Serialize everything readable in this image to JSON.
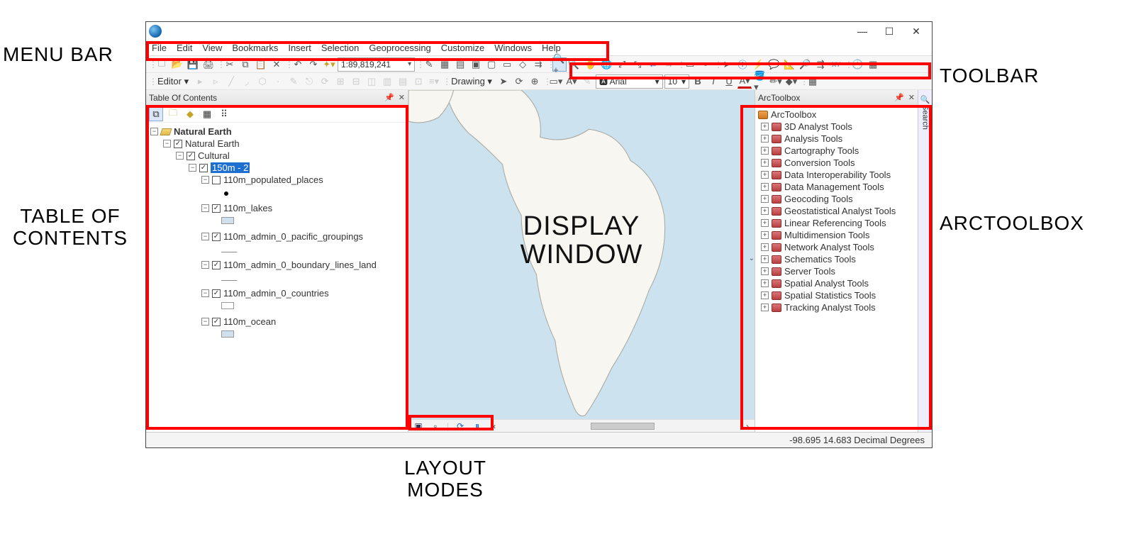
{
  "annotations": {
    "menubar": "MENU BAR",
    "toolbar": "TOOLBAR",
    "toc": "TABLE OF\nCONTENTS",
    "arctoolbox": "ARCTOOLBOX",
    "display": "DISPLAY\nWINDOW",
    "layoutmodes": "LAYOUT\nMODES"
  },
  "menubar": {
    "items": [
      "File",
      "Edit",
      "View",
      "Bookmarks",
      "Insert",
      "Selection",
      "Geoprocessing",
      "Customize",
      "Windows",
      "Help"
    ]
  },
  "toolbar": {
    "scale": "1:89,819,241",
    "editor_label": "Editor ▾",
    "drawing_label": "Drawing ▾",
    "font": "Arial",
    "font_size": "10"
  },
  "toc": {
    "title": "Table Of Contents",
    "root": "Natural Earth",
    "dataframe": "Natural Earth",
    "group": "Cultural",
    "sel_layer": "150m - 2",
    "layers": [
      {
        "name": "110m_populated_places",
        "checked": false,
        "swatch": "dot"
      },
      {
        "name": "110m_lakes",
        "checked": true,
        "swatch": "#cfe1ef"
      },
      {
        "name": "110m_admin_0_pacific_groupings",
        "checked": true,
        "swatch": "line"
      },
      {
        "name": "110m_admin_0_boundary_lines_land",
        "checked": true,
        "swatch": "line"
      },
      {
        "name": "110m_admin_0_countries",
        "checked": true,
        "swatch": "#ffffff"
      },
      {
        "name": "110m_ocean",
        "checked": true,
        "swatch": "#cfe1ef"
      }
    ]
  },
  "arctoolbox": {
    "title": "ArcToolbox",
    "root": "ArcToolbox",
    "search_tab": "Search",
    "tools": [
      "3D Analyst Tools",
      "Analysis Tools",
      "Cartography Tools",
      "Conversion Tools",
      "Data Interoperability Tools",
      "Data Management Tools",
      "Geocoding Tools",
      "Geostatistical Analyst Tools",
      "Linear Referencing Tools",
      "Multidimension Tools",
      "Network Analyst Tools",
      "Schematics Tools",
      "Server Tools",
      "Spatial Analyst Tools",
      "Spatial Statistics Tools",
      "Tracking Analyst Tools"
    ]
  },
  "statusbar": {
    "coords": "-98.695  14.683 Decimal Degrees"
  }
}
